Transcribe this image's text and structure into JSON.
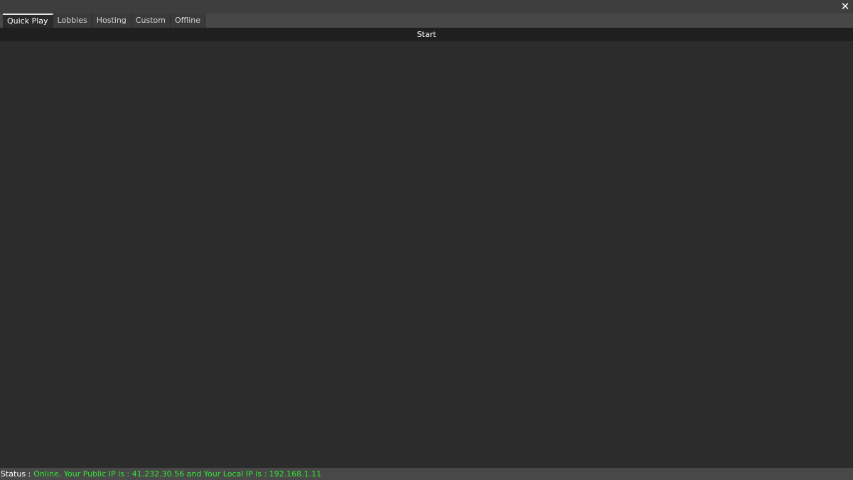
{
  "window": {
    "close_glyph": "✕"
  },
  "tabs": [
    {
      "label": "Quick Play",
      "active": true
    },
    {
      "label": "Lobbies",
      "active": false
    },
    {
      "label": "Hosting",
      "active": false
    },
    {
      "label": "Custom",
      "active": false
    },
    {
      "label": "Offline",
      "active": false
    }
  ],
  "start": {
    "label": "Start"
  },
  "status": {
    "label": "Status :",
    "text": "Online, Your Public IP is : 41.232.30.56 and Your Local IP is : 192.168.1.11"
  },
  "colors": {
    "background": "#2c2c2c",
    "status_online": "#33e633",
    "start_bar": "#1f1f1f"
  }
}
